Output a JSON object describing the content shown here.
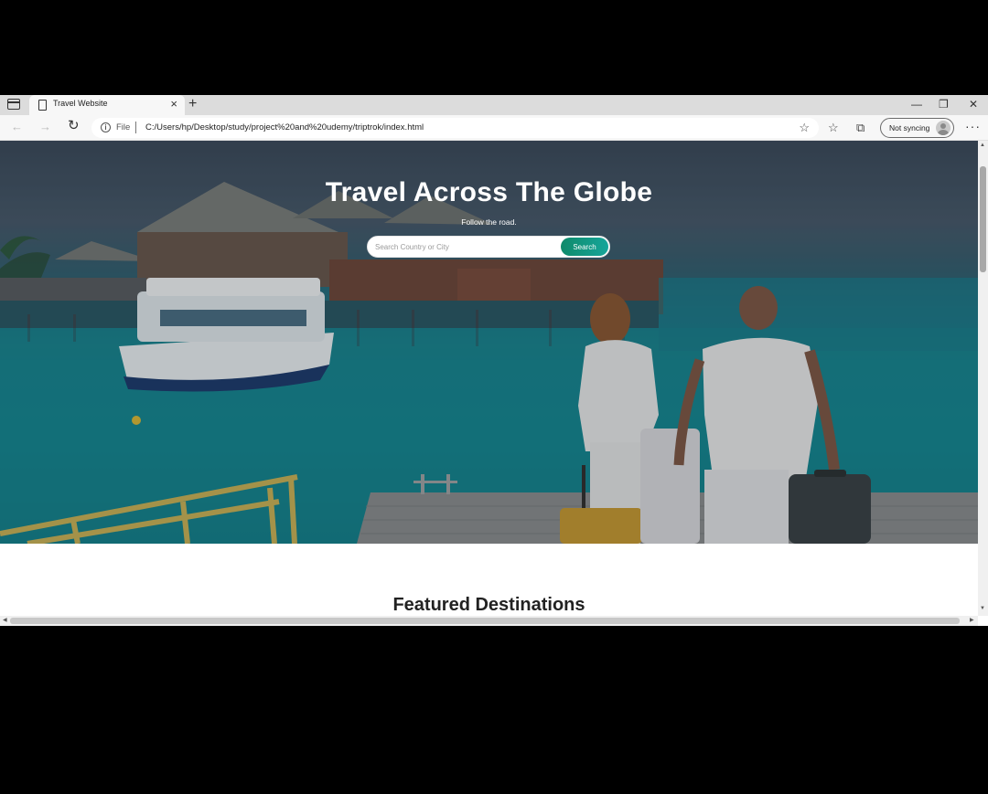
{
  "browser": {
    "tab_title": "Travel Website",
    "tab_close": "×",
    "new_tab": "+",
    "minimize": "—",
    "restore": "❐",
    "close": "✕",
    "back": "←",
    "forward": "→",
    "reload": "↻",
    "info": "i",
    "file_label": "File",
    "url": "C:/Users/hp/Desktop/study/project%20and%20udemy/triptrok/index.html",
    "favorite_add": "☆",
    "favorites": "☆",
    "collections": "⧉",
    "sync_label": "Not syncing",
    "more": "···"
  },
  "hero": {
    "title": "Travel Across The Globe",
    "subtitle": "Follow the road.",
    "search_placeholder": "Search Country or City",
    "search_button": "Search"
  },
  "featured": {
    "title": "Featured Destinations"
  },
  "colors": {
    "accent": "#13a08a",
    "sea": "#178893"
  }
}
